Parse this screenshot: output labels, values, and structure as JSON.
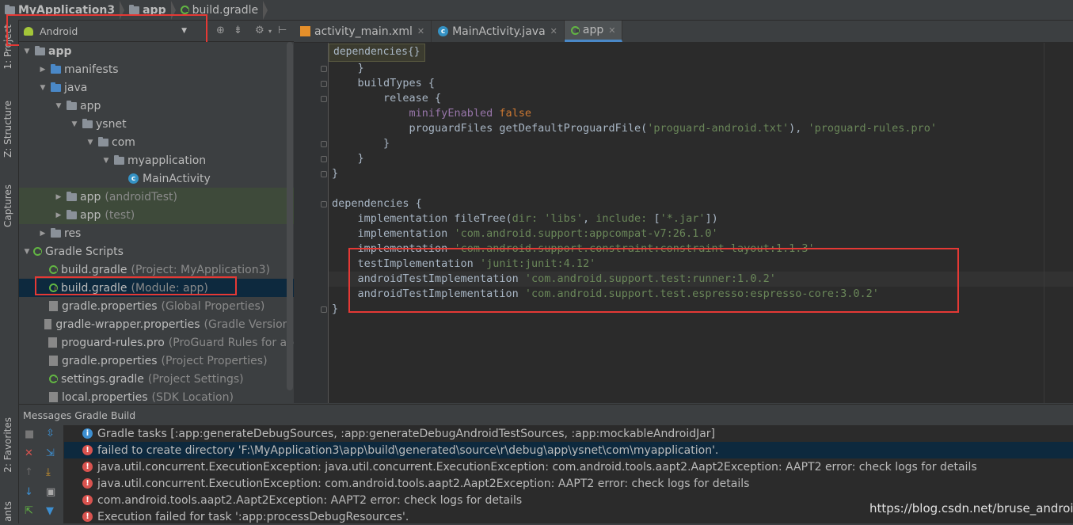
{
  "breadcrumb": [
    "MyApplication3",
    "app",
    "build.gradle"
  ],
  "stripe": {
    "project": "1: Project",
    "structure": "Z: Structure",
    "captures": "Captures",
    "favorites": "2: Favorites",
    "variants": "ants"
  },
  "project_view": {
    "selected": "Android"
  },
  "tree": [
    {
      "label": "app",
      "hint": "",
      "icon": "folder",
      "arrow": "down",
      "level": 0,
      "bold": true
    },
    {
      "label": "manifests",
      "hint": "",
      "icon": "folder-blue",
      "arrow": "right",
      "level": 1
    },
    {
      "label": "java",
      "hint": "",
      "icon": "folder-blue",
      "arrow": "down",
      "level": 1
    },
    {
      "label": "app",
      "hint": "",
      "icon": "package",
      "arrow": "down",
      "level": 2
    },
    {
      "label": "ysnet",
      "hint": "",
      "icon": "package",
      "arrow": "down",
      "level": 3
    },
    {
      "label": "com",
      "hint": "",
      "icon": "package",
      "arrow": "down",
      "level": 4
    },
    {
      "label": "myapplication",
      "hint": "",
      "icon": "package",
      "arrow": "down",
      "level": 5
    },
    {
      "label": "MainActivity",
      "hint": "",
      "icon": "class",
      "arrow": "",
      "level": 6
    },
    {
      "label": "app",
      "hint": "(androidTest)",
      "icon": "package",
      "arrow": "right",
      "level": 2,
      "test": true
    },
    {
      "label": "app",
      "hint": "(test)",
      "icon": "package",
      "arrow": "right",
      "level": 2,
      "test": true
    },
    {
      "label": "res",
      "hint": "",
      "icon": "res-folder",
      "arrow": "right",
      "level": 1
    },
    {
      "label": "Gradle Scripts",
      "hint": "",
      "icon": "gradle",
      "arrow": "down",
      "level": 0
    },
    {
      "label": "build.gradle",
      "hint": "(Project: MyApplication3)",
      "icon": "gradle",
      "arrow": "",
      "level": 1
    },
    {
      "label": "build.gradle",
      "hint": "(Module: app)",
      "icon": "gradle",
      "arrow": "",
      "level": 1,
      "selected": true
    },
    {
      "label": "gradle.properties",
      "hint": "(Global Properties)",
      "icon": "properties",
      "arrow": "",
      "level": 1
    },
    {
      "label": "gradle-wrapper.properties",
      "hint": "(Gradle Version)",
      "icon": "properties",
      "arrow": "",
      "level": 1
    },
    {
      "label": "proguard-rules.pro",
      "hint": "(ProGuard Rules for ap",
      "icon": "file",
      "arrow": "",
      "level": 1
    },
    {
      "label": "gradle.properties",
      "hint": "(Project Properties)",
      "icon": "properties",
      "arrow": "",
      "level": 1
    },
    {
      "label": "settings.gradle",
      "hint": "(Project Settings)",
      "icon": "gradle",
      "arrow": "",
      "level": 1
    },
    {
      "label": "local.properties",
      "hint": "(SDK Location)",
      "icon": "properties",
      "arrow": "",
      "level": 1
    }
  ],
  "tabs": [
    {
      "label": "activity_main.xml",
      "icon": "xml-icon",
      "active": false
    },
    {
      "label": "MainActivity.java",
      "icon": "class-icon",
      "active": false
    },
    {
      "label": "app",
      "icon": "gradle-icon",
      "active": true
    }
  ],
  "editor": {
    "breadcrumb_tip": "dependencies{}",
    "lines": [
      {
        "indent": 4,
        "parts": [
          {
            "t": "}",
            "c": ""
          }
        ]
      },
      {
        "indent": 4,
        "parts": [
          {
            "t": "buildTypes {",
            "c": ""
          }
        ]
      },
      {
        "indent": 8,
        "parts": [
          {
            "t": "release {",
            "c": ""
          }
        ]
      },
      {
        "indent": 12,
        "parts": [
          {
            "t": "minifyEnabled ",
            "c": "prop"
          },
          {
            "t": "false",
            "c": "kw"
          }
        ]
      },
      {
        "indent": 12,
        "parts": [
          {
            "t": "proguardFiles getDefaultProguardFile(",
            "c": ""
          },
          {
            "t": "'proguard-android.txt'",
            "c": "str"
          },
          {
            "t": "), ",
            "c": ""
          },
          {
            "t": "'proguard-rules.pro'",
            "c": "str"
          }
        ]
      },
      {
        "indent": 8,
        "parts": [
          {
            "t": "}",
            "c": ""
          }
        ]
      },
      {
        "indent": 4,
        "parts": [
          {
            "t": "}",
            "c": ""
          }
        ]
      },
      {
        "indent": 0,
        "parts": [
          {
            "t": "}",
            "c": ""
          }
        ]
      },
      {
        "indent": 0,
        "parts": [
          {
            "t": "",
            "c": ""
          }
        ]
      },
      {
        "indent": 0,
        "parts": [
          {
            "t": "dependencies {",
            "c": ""
          }
        ]
      },
      {
        "indent": 4,
        "parts": [
          {
            "t": "implementation fileTree(",
            "c": ""
          },
          {
            "t": "dir: ",
            "c": "str"
          },
          {
            "t": "'libs'",
            "c": "str"
          },
          {
            "t": ", ",
            "c": ""
          },
          {
            "t": "include: ",
            "c": "str"
          },
          {
            "t": "[",
            "c": ""
          },
          {
            "t": "'*.jar'",
            "c": "str"
          },
          {
            "t": "])",
            "c": ""
          }
        ]
      },
      {
        "indent": 4,
        "parts": [
          {
            "t": "implementation ",
            "c": ""
          },
          {
            "t": "'com.android.support:appcompat-v7:26.1.0'",
            "c": "str"
          }
        ]
      },
      {
        "indent": 4,
        "parts": [
          {
            "t": "implementation ",
            "c": ""
          },
          {
            "t": "'com.android.support.constraint:constraint-layout:1.1.3'",
            "c": "str"
          }
        ]
      },
      {
        "indent": 4,
        "parts": [
          {
            "t": "testImplementation ",
            "c": ""
          },
          {
            "t": "'junit:junit:4.12'",
            "c": "str"
          }
        ]
      },
      {
        "indent": 4,
        "parts": [
          {
            "t": "androidTestImplementation ",
            "c": ""
          },
          {
            "t": "'com.android.support.test:runner:1.0.2'",
            "c": "str"
          }
        ]
      },
      {
        "indent": 4,
        "parts": [
          {
            "t": "androidTestImplementation ",
            "c": ""
          },
          {
            "t": "'com.android.support.test.espresso:espresso-core:3.0.2'",
            "c": "str"
          }
        ]
      },
      {
        "indent": 0,
        "parts": [
          {
            "t": "}",
            "c": ""
          }
        ]
      }
    ]
  },
  "messages": {
    "header": "Messages Gradle Build",
    "items": [
      {
        "type": "info",
        "text": "Gradle tasks [:app:generateDebugSources, :app:generateDebugAndroidTestSources, :app:mockableAndroidJar]"
      },
      {
        "type": "error",
        "text": "failed to create directory 'F:\\MyApplication3\\app\\build\\generated\\source\\r\\debug\\app\\ysnet\\com\\myapplication'.",
        "selected": true
      },
      {
        "type": "error",
        "text": "java.util.concurrent.ExecutionException: java.util.concurrent.ExecutionException: com.android.tools.aapt2.Aapt2Exception: AAPT2 error: check logs for details"
      },
      {
        "type": "error",
        "text": "java.util.concurrent.ExecutionException: com.android.tools.aapt2.Aapt2Exception: AAPT2 error: check logs for details"
      },
      {
        "type": "error",
        "text": "com.android.tools.aapt2.Aapt2Exception: AAPT2 error: check logs for details"
      },
      {
        "type": "error",
        "text": "Execution failed for task ':app:processDebugResources'."
      }
    ]
  },
  "watermark": "https://blog.csdn.net/bruse_android"
}
